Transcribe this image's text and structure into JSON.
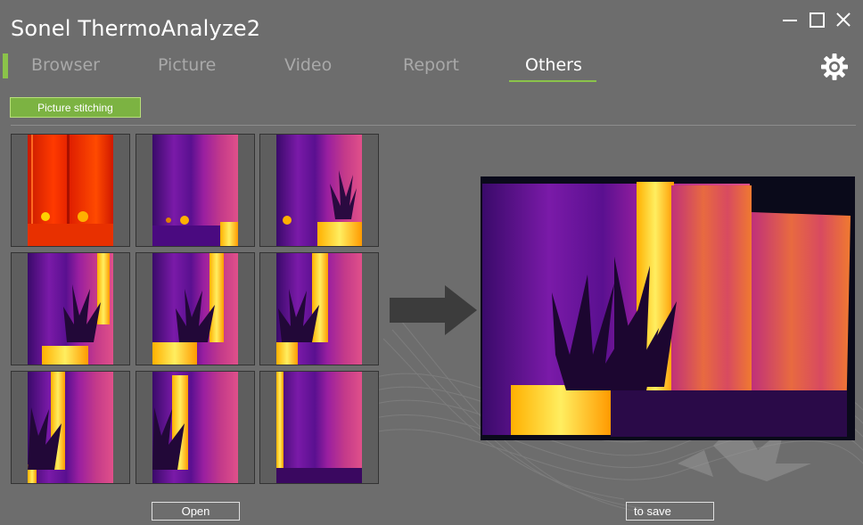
{
  "window": {
    "title": "Sonel ThermoAnalyze2",
    "controls": [
      "minimize",
      "maximize",
      "close"
    ]
  },
  "tabs": [
    {
      "label": "Browser",
      "active": false
    },
    {
      "label": "Picture",
      "active": false
    },
    {
      "label": "Video",
      "active": false
    },
    {
      "label": "Report",
      "active": false
    },
    {
      "label": "Others",
      "active": true
    }
  ],
  "toolbar": {
    "settings_icon": "gear-icon",
    "mode_button": "Picture stitching"
  },
  "thumbnails": [
    {
      "palette": "red"
    },
    {
      "palette": "iron"
    },
    {
      "palette": "iron"
    },
    {
      "palette": "iron"
    },
    {
      "palette": "iron"
    },
    {
      "palette": "iron"
    },
    {
      "palette": "iron"
    },
    {
      "palette": "iron"
    },
    {
      "palette": "iron"
    }
  ],
  "actions": {
    "open_label": "Open",
    "save_label": "to save"
  },
  "colors": {
    "accent": "#8bc34a",
    "background": "#6d6d6d"
  }
}
